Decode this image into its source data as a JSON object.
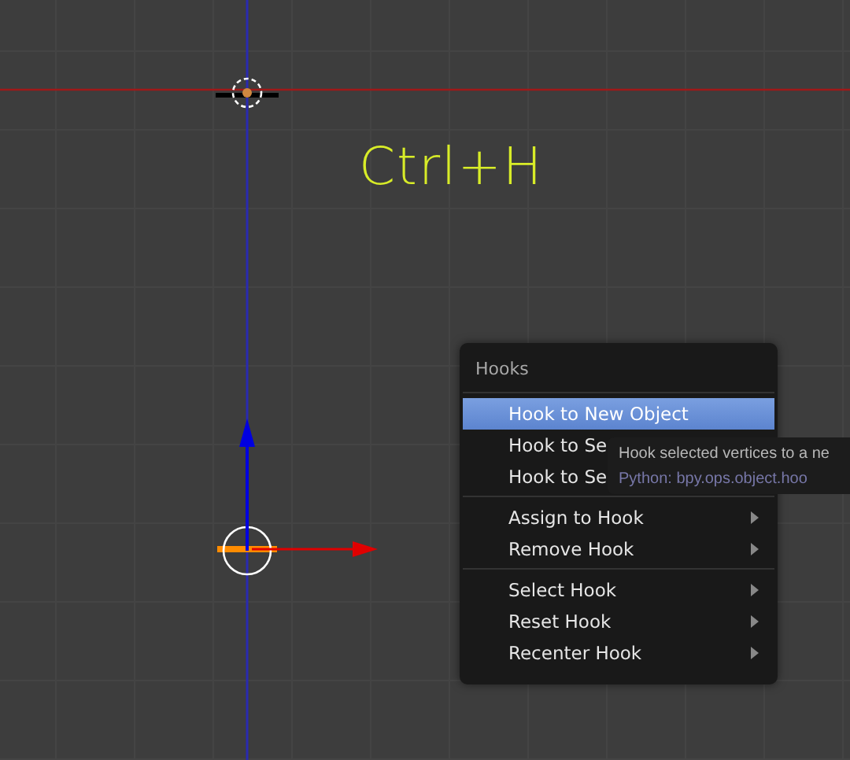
{
  "viewport": {
    "overlay_text": "Ctrl+H"
  },
  "menu": {
    "title": "Hooks",
    "groups": [
      [
        {
          "label": "Hook to New Object",
          "selected": true
        },
        {
          "label": "Hook to Se",
          "selected": false
        },
        {
          "label": "Hook to Se",
          "selected": false
        }
      ],
      [
        {
          "label": "Assign to Hook",
          "selected": false,
          "submenu": true
        },
        {
          "label": "Remove Hook",
          "selected": false,
          "submenu": true
        }
      ],
      [
        {
          "label": "Select Hook",
          "selected": false,
          "submenu": true
        },
        {
          "label": "Reset Hook",
          "selected": false,
          "submenu": true
        },
        {
          "label": "Recenter Hook",
          "selected": false,
          "submenu": true
        }
      ]
    ]
  },
  "tooltip": {
    "description": "Hook selected vertices to a ne",
    "python": "Python: bpy.ops.object.hoo"
  }
}
